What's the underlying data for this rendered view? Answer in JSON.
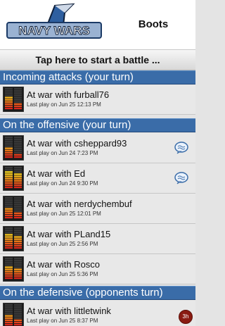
{
  "header": {
    "logo_text": "NAVY WARS",
    "username": "Boots"
  },
  "start_battle_label": "Tap here to start a battle ...",
  "sections": {
    "incoming": "Incoming attacks (your turn)",
    "offensive": "On the offensive (your turn)",
    "defensive": "On the defensive (opponents turn)"
  },
  "games": [
    {
      "title": "At war with furball76",
      "subtitle": "Last play on Jun 25 12:13 PM",
      "icon": "radar-status-icon",
      "status_levels": [
        0.6,
        0.3
      ]
    },
    {
      "title": "At war with csheppard93",
      "subtitle": "Last play on Jun 24 7:23 PM",
      "icon": "radar-status-icon",
      "status_levels": [
        0.5,
        0.2
      ],
      "badge": "chat-bubble-icon"
    },
    {
      "title": "At war with Ed",
      "subtitle": "Last play on Jun 24 9:30 PM",
      "icon": "radar-status-icon",
      "status_levels": [
        0.8,
        0.7
      ],
      "badge": "chat-bubble-icon"
    },
    {
      "title": "At war with nerdychembuf",
      "subtitle": "Last play on Jun 25 12:01 PM",
      "icon": "radar-status-icon",
      "status_levels": [
        0.5,
        0.3
      ]
    },
    {
      "title": "At war with PLand15",
      "subtitle": "Last play on Jun 25 2:56 PM",
      "icon": "radar-status-icon",
      "status_levels": [
        0.7,
        0.6
      ]
    },
    {
      "title": "At war with Rosco",
      "subtitle": "Last play on Jun 25 5:36 PM",
      "icon": "radar-status-icon",
      "status_levels": [
        0.6,
        0.5
      ]
    },
    {
      "title": "At war with littletwink",
      "subtitle": "Last play on Jun 25 8:37 PM",
      "icon": "radar-status-icon",
      "status_levels": [
        0.5,
        0.3
      ],
      "badge_text": "3h"
    }
  ],
  "colors": {
    "section_blue": "#3a6ca8",
    "badge_red": "#8a1b12",
    "logo_blue": "#2e5fa0"
  }
}
